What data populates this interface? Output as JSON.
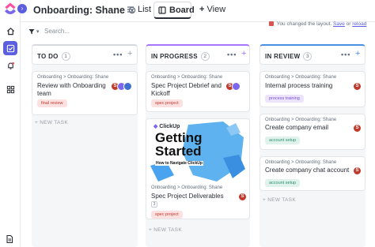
{
  "header": {
    "title": "Onboarding: Shane",
    "views": [
      {
        "label": "List",
        "icon": "list-icon"
      },
      {
        "label": "Board",
        "icon": "board-icon",
        "active": true
      },
      {
        "label": "View",
        "icon": "plus-icon"
      }
    ]
  },
  "toolbar": {
    "search_placeholder": "Search...",
    "notice_text": "You changed the layout.",
    "notice_save": "Save",
    "notice_or": "or",
    "notice_reload": "reload"
  },
  "columns": [
    {
      "name": "TO DO",
      "count": "1",
      "accent": "#d6d9de",
      "cards": [
        {
          "breadcrumb": "Onboarding > Onboarding: Shane",
          "title": "Review with Onboarding team",
          "tag": "final review",
          "tag_color": "#fde1e1",
          "tag_text": "#c0392b",
          "avatars": [
            "S",
            "",
            ""
          ]
        }
      ],
      "new_task": "+ NEW TASK"
    },
    {
      "name": "IN PROGRESS",
      "count": "2",
      "accent": "#a875ff",
      "cards": [
        {
          "breadcrumb": "Onboarding > Onboarding: Shane",
          "title": "Spec Project Debrief and Kickoff",
          "tag": "spec project",
          "tag_color": "#fde1e1",
          "tag_text": "#c0392b",
          "avatars": [
            "S",
            ""
          ]
        },
        {
          "breadcrumb": "Onboarding > Onboarding: Shane",
          "title": "Spec Project Deliverables",
          "tag": "spec project",
          "tag_color": "#fde1e1",
          "tag_text": "#c0392b",
          "subtasks": "3",
          "avatars": [
            "S"
          ],
          "cover": {
            "brand": "ClickUp",
            "headline_1": "Getting",
            "headline_2": "Started",
            "subtitle": "How to Navigate ClickUp"
          }
        }
      ],
      "new_task": "+ NEW TASK"
    },
    {
      "name": "IN REVIEW",
      "count": "3",
      "accent": "#4a90e2",
      "cards": [
        {
          "breadcrumb": "Onboarding > Onboarding: Shane",
          "title": "Internal process training",
          "tag": "process training",
          "tag_color": "#ece4fb",
          "tag_text": "#7b4fd6",
          "avatars": [
            "S"
          ]
        },
        {
          "breadcrumb": "Onboarding > Onboarding: Shane",
          "title": "Create company email",
          "tag": "account setup",
          "tag_color": "#dff3ec",
          "tag_text": "#2f8f6e",
          "avatars": [
            "S"
          ]
        },
        {
          "breadcrumb": "Onboarding > Onboarding: Shane",
          "title": "Create company chat account",
          "tag": "account setup",
          "tag_color": "#dff3ec",
          "tag_text": "#2f8f6e",
          "avatars": [
            "S"
          ]
        }
      ],
      "new_task": "+ NEW TASK"
    }
  ]
}
